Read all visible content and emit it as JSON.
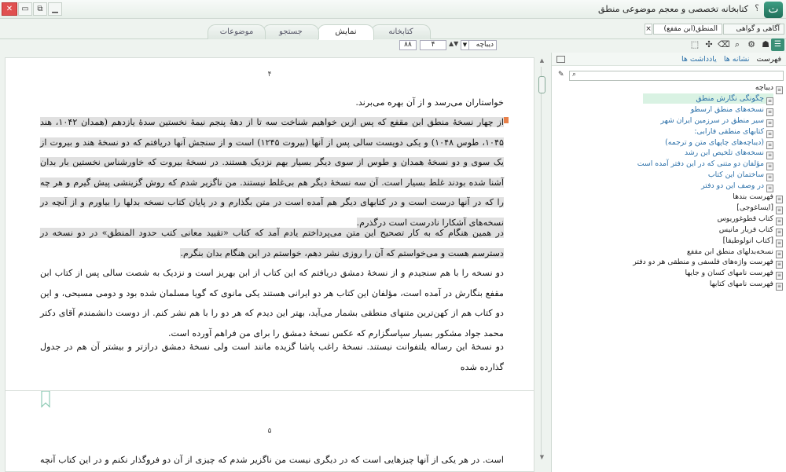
{
  "window": {
    "title": "کتابخانه تخصصی و معجم موضوعی منطق",
    "help": "؟",
    "logo": "ت",
    "controls": {
      "close": "✕",
      "maximize": "▭",
      "restore": "⧉",
      "minimize": "▁"
    }
  },
  "main_tabs": [
    {
      "label": "کتابخانه",
      "active": false
    },
    {
      "label": "نمایش",
      "active": true
    },
    {
      "label": "جستجو",
      "active": false
    },
    {
      "label": "موضوعات",
      "active": false
    }
  ],
  "doc_tabs": [
    {
      "label": "المنطق(ابن مقفع)",
      "active": true,
      "close": "×"
    },
    {
      "label": "آگاهی و گواهی",
      "active": false
    }
  ],
  "toolbar": {
    "zoom": "۸۸",
    "page": "۴",
    "section": "دیباچه"
  },
  "document": {
    "page_top": "۴",
    "page_bottom": "۵",
    "paragraphs": [
      {
        "text": "خواستاران می‌رسد و از آن بهره می‌برند.",
        "highlight": false
      },
      {
        "text": "از چهار نسخهٔ منطق ابن مقفع که پس ازین خواهیم شناخت سه تا از دههٔ پنجم نیمهٔ نخستین سدهٔ یازدهم (همدان ۱۰۴۲، هند ۱۰۴۵، طوس ۱۰۴۸) و یکی دویست سالی پس از آنها (بیروت ۱۲۴۵) است و از سنجش آنها دریافتم که دو نسخهٔ هند و بیروت از یک سوی و دو نسخهٔ همدان و طوس از سوی دیگر بسیار بهم نزدیک هستند. در نسخهٔ بیروت که خاورشناس نخستین بار بدان آشنا شده بودند غلط بسیار است. آن سه نسخهٔ دیگر هم بی‌غلط نیستند. من ناگزیر شدم که روش گزینشی پیش گیرم و هر چه را که در آنها درست است و در کتابهای دیگر هم آمده است در متن بگذارم و در پایان کتاب نسخه بدلها را بیاورم و از آنچه در نسخه‌های آشکارا نادرست است درگذرم.",
        "highlight": true
      },
      {
        "text": "در همین هنگام که به کار تصحیح این متن می‌پرداختم یادم آمد که کتاب «تقیید معانی کتب حدود المنطق» در دو نسخه در دسترسم هست و می‌خواستم که آن را روزی نشر دهم، خواستم در این هنگام بدان بنگرم.",
        "highlight": true
      },
      {
        "text": "دو نسخه را با هم سنجیدم و از نسخهٔ دمشق دریافتم که این کتاب از ابن بهریز است و نزدیک به شصت سالی پس از کتاب ابن مقفع بنگارش در آمده است، مؤلفان این کتاب هر دو ایرانی هستند یکی مانوی که گویا مسلمان شده بود و دومی مسیحی، و این دو کتاب هم از کهن‌ترین متنهای منطقی بشمار می‌آید، بهتر این دیدم که هر دو را با هم نشر کنم. از دوست دانشمندم آقای دکتر محمد جواد مشکور بسیار سپاسگزارم که عکس نسخهٔ دمشق را برای من فراهم آورده است.",
        "highlight": false
      },
      {
        "text": "دو نسخهٔ این رساله یلتفوانت نیستند. نسخهٔ راغب پاشا گزیده مانند است ولی نسخهٔ دمشق درازتر و بیشتر آن هم در جدول گذارده شده",
        "highlight": false
      },
      {
        "text": "است. در هر یکی از آنها چیزهایی است که در دیگری نیست من ناگزیر شدم که چیزی از آن دو فروگذار نکنم و در این کتاب آنچه در هر",
        "highlight": false
      }
    ]
  },
  "side_panel": {
    "title": "فهرست",
    "bookmarks_link": "نشانه ها",
    "notes_link": "یادداشت ها",
    "search_placeholder": "",
    "tree": [
      {
        "label": "دیباچه",
        "style": "plain",
        "level": 0,
        "selected": false
      },
      {
        "label": "چگونگی نگارش منطق",
        "style": "link",
        "level": 1,
        "selected": true
      },
      {
        "label": "نسخه‌های منطق ارسطو",
        "style": "link",
        "level": 1,
        "selected": false
      },
      {
        "label": "سیر منطق در سرزمین ایران شهر",
        "style": "link",
        "level": 1,
        "selected": false
      },
      {
        "label": "کتابهای منطقی فارابی:",
        "style": "link",
        "level": 1,
        "selected": false
      },
      {
        "label": "(دیباچه‌های چاپهای متن و ترجمه)",
        "style": "link",
        "level": 1,
        "selected": false
      },
      {
        "label": "نسخه‌های تلخیص ابن رشد",
        "style": "link",
        "level": 1,
        "selected": false
      },
      {
        "label": "مؤلفان دو متنی که در این دفتر آمده است",
        "style": "link",
        "level": 1,
        "selected": false
      },
      {
        "label": "ساختمان این کتاب",
        "style": "link",
        "level": 1,
        "selected": false
      },
      {
        "label": "در وصف این دو دفتر",
        "style": "link",
        "level": 1,
        "selected": false
      },
      {
        "label": "فهرست بندها",
        "style": "plain",
        "level": 0,
        "selected": false
      },
      {
        "label": "[ایساغوجی]",
        "style": "plain",
        "level": 0,
        "selected": false
      },
      {
        "label": "کتاب قطوغوریوس",
        "style": "plain",
        "level": 0,
        "selected": false
      },
      {
        "label": "کتاب فریار مانیس",
        "style": "plain",
        "level": 0,
        "selected": false
      },
      {
        "label": "[کتاب انولوطیقا]",
        "style": "plain",
        "level": 0,
        "selected": false
      },
      {
        "label": "نسخه‌بدلهای منطق ابن مقفع",
        "style": "plain",
        "level": 0,
        "selected": false
      },
      {
        "label": "فهرست واژه‌های فلسفی و منطقی هر دو دفتر",
        "style": "plain",
        "level": 0,
        "selected": false
      },
      {
        "label": "فهرست نامهای کسان و جایها",
        "style": "plain",
        "level": 0,
        "selected": false
      },
      {
        "label": "فهرست نامهای کتابها",
        "style": "plain",
        "level": 0,
        "selected": false
      }
    ]
  },
  "colors": {
    "accent": "#3a8f76",
    "link": "#2a6fa8",
    "highlight": "#e0e0e0",
    "note_marker": "#e8804a",
    "selected_row": "#d9f2e3"
  }
}
